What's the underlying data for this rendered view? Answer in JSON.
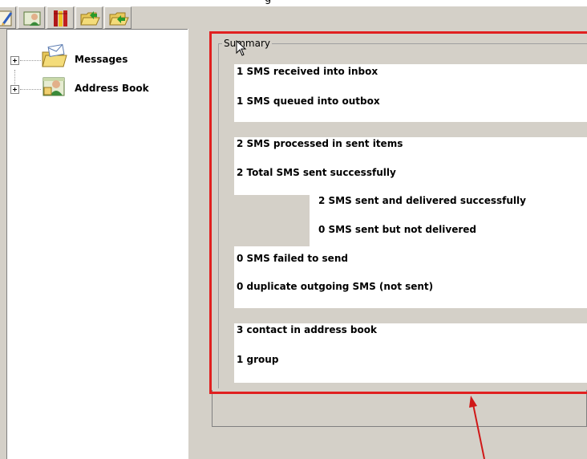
{
  "window": {
    "title_fragment": "g"
  },
  "tree": {
    "items": [
      {
        "label": "Messages",
        "icon": "messages-folder-icon"
      },
      {
        "label": "Address Book",
        "icon": "address-book-icon"
      }
    ]
  },
  "summary": {
    "legend": "Summary",
    "lines": [
      "1 SMS received into inbox",
      "1 SMS queued into outbox",
      "2 SMS processed in sent items",
      "2 Total SMS sent successfully",
      "2 SMS sent and delivered successfully",
      "0 SMS sent but not delivered",
      "0 SMS failed to send",
      "0 duplicate outgoing SMS (not sent)",
      "3 contact in address book",
      "1 group"
    ]
  },
  "colors": {
    "highlight": "#e02020",
    "panel_bg": "#ffffff",
    "window_bg": "#d4d0c8"
  }
}
